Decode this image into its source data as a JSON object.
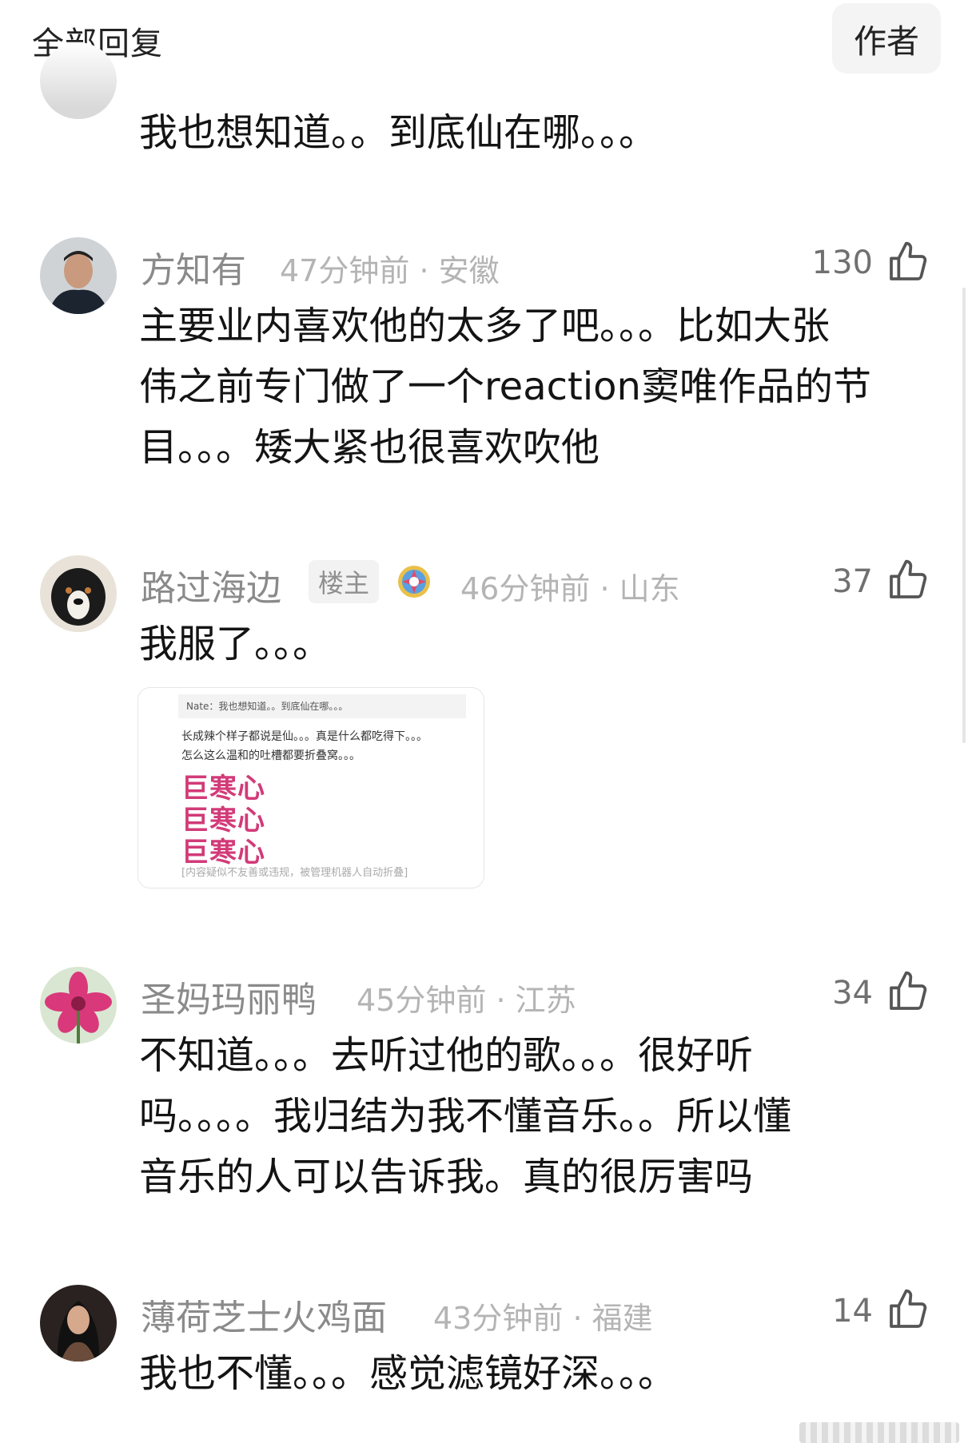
{
  "header": {
    "title": "全部回复",
    "filter_label": "作者"
  },
  "comments": [
    {
      "text": "我也想知道。。到底仙在哪。。。"
    },
    {
      "name": "方知有",
      "time": "47分钟前",
      "location": "安徽",
      "likes": "130",
      "lines": [
        "主要业内喜欢他的太多了吧。。。比如大张",
        "伟之前专门做了一个reaction窦唯作品的节",
        "目。。。矮大紧也很喜欢吹他"
      ]
    },
    {
      "name": "路过海边",
      "badge": "楼主",
      "time": "46分钟前",
      "location": "山东",
      "likes": "37",
      "lines": [
        "我服了。。。"
      ],
      "quote": {
        "header": "Nate：我也想知道。。到底仙在哪。。。",
        "line1": "长成辣个样子都说是仙。。。真是什么都吃得下。。。",
        "line2": "怎么这么温和的吐槽都要折叠窝。。。",
        "big": [
          "巨寒心",
          "巨寒心",
          "巨寒心"
        ],
        "footer": "[内容疑似不友善或违规，被管理机器人自动折叠]"
      }
    },
    {
      "name": "圣妈玛丽鸭",
      "time": "45分钟前",
      "location": "江苏",
      "likes": "34",
      "lines": [
        "不知道。。。去听过他的歌。。。很好听",
        "吗。。。。我归结为我不懂音乐。。所以懂",
        "音乐的人可以告诉我。真的很厉害吗"
      ]
    },
    {
      "name": "薄荷芝士火鸡面",
      "time": "43分钟前",
      "location": "福建",
      "likes": "14",
      "lines": [
        "我也不懂。。。感觉滤镜好深。。。"
      ]
    }
  ],
  "meta_separator": " · ",
  "colors": {
    "name": "#8a8a8a",
    "meta": "#b4b4b4",
    "quote_big": "#d23a78"
  },
  "icons": [
    "thumbs-up-icon",
    "medal-icon"
  ]
}
